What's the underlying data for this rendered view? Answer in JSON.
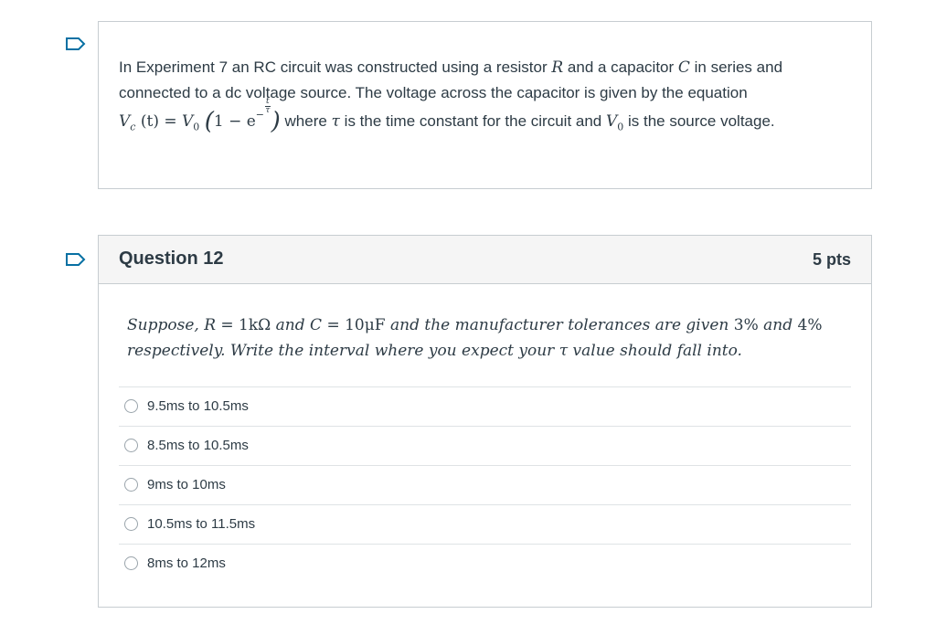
{
  "intro": {
    "flag_icon": "bookmark-flag-icon",
    "t1": "In Experiment 7 an RC circuit was constructed using a resistor ",
    "R": "R",
    "t2": " and a capacitor ",
    "C": "C",
    "t3": " in series and",
    "line2": "connected to a dc voltage source. The voltage across the capacitor is given by the equation",
    "eq_Vc": "V",
    "eq_c": "c",
    "eq_t_arg": " (t) = ",
    "eq_V0": "V",
    "eq_0": "0",
    "eq_open": "(",
    "eq_inner": "1 − e",
    "eq_minus": "−",
    "eq_frac_num": "t",
    "eq_frac_den": "τ",
    "eq_close": ")",
    "t4": " where ",
    "tau": "τ",
    "t5": " is the time constant for the circuit and ",
    "V0b": "V",
    "V0b_sub": "0",
    "t6": " is the source voltage."
  },
  "question": {
    "flag_icon": "bookmark-flag-icon",
    "title": "Question 12",
    "points": "5 pts",
    "text_line1_a": "Suppose, ",
    "text_R": "R",
    "text_eq1": " = 1kΩ",
    "text_and": " and ",
    "text_C": "C",
    "text_eq2": " = 10μF",
    "text_rest1": " and the manufacturer tolerances are given ",
    "text_p1": "3%",
    "text_and2": " and ",
    "text_p2": "4%",
    "text_line2_a": "respectively. Write the interval where you expect your ",
    "text_tau": "τ",
    "text_line2_b": " value should fall into.",
    "answers": [
      {
        "label": "9.5ms to 10.5ms"
      },
      {
        "label": "8.5ms to 10.5ms"
      },
      {
        "label": "9ms to 10ms"
      },
      {
        "label": "10.5ms to 11.5ms"
      },
      {
        "label": "8ms to 12ms"
      }
    ]
  }
}
